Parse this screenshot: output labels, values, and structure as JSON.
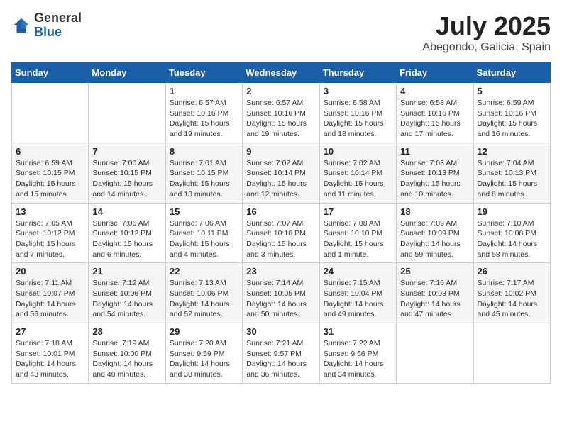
{
  "logo": {
    "general": "General",
    "blue": "Blue"
  },
  "title": "July 2025",
  "location": "Abegondo, Galicia, Spain",
  "weekdays": [
    "Sunday",
    "Monday",
    "Tuesday",
    "Wednesday",
    "Thursday",
    "Friday",
    "Saturday"
  ],
  "weeks": [
    [
      {
        "day": "",
        "info": ""
      },
      {
        "day": "",
        "info": ""
      },
      {
        "day": "1",
        "info": "Sunrise: 6:57 AM\nSunset: 10:16 PM\nDaylight: 15 hours\nand 19 minutes."
      },
      {
        "day": "2",
        "info": "Sunrise: 6:57 AM\nSunset: 10:16 PM\nDaylight: 15 hours\nand 19 minutes."
      },
      {
        "day": "3",
        "info": "Sunrise: 6:58 AM\nSunset: 10:16 PM\nDaylight: 15 hours\nand 18 minutes."
      },
      {
        "day": "4",
        "info": "Sunrise: 6:58 AM\nSunset: 10:16 PM\nDaylight: 15 hours\nand 17 minutes."
      },
      {
        "day": "5",
        "info": "Sunrise: 6:59 AM\nSunset: 10:16 PM\nDaylight: 15 hours\nand 16 minutes."
      }
    ],
    [
      {
        "day": "6",
        "info": "Sunrise: 6:59 AM\nSunset: 10:15 PM\nDaylight: 15 hours\nand 15 minutes."
      },
      {
        "day": "7",
        "info": "Sunrise: 7:00 AM\nSunset: 10:15 PM\nDaylight: 15 hours\nand 14 minutes."
      },
      {
        "day": "8",
        "info": "Sunrise: 7:01 AM\nSunset: 10:15 PM\nDaylight: 15 hours\nand 13 minutes."
      },
      {
        "day": "9",
        "info": "Sunrise: 7:02 AM\nSunset: 10:14 PM\nDaylight: 15 hours\nand 12 minutes."
      },
      {
        "day": "10",
        "info": "Sunrise: 7:02 AM\nSunset: 10:14 PM\nDaylight: 15 hours\nand 11 minutes."
      },
      {
        "day": "11",
        "info": "Sunrise: 7:03 AM\nSunset: 10:13 PM\nDaylight: 15 hours\nand 10 minutes."
      },
      {
        "day": "12",
        "info": "Sunrise: 7:04 AM\nSunset: 10:13 PM\nDaylight: 15 hours\nand 8 minutes."
      }
    ],
    [
      {
        "day": "13",
        "info": "Sunrise: 7:05 AM\nSunset: 10:12 PM\nDaylight: 15 hours\nand 7 minutes."
      },
      {
        "day": "14",
        "info": "Sunrise: 7:06 AM\nSunset: 10:12 PM\nDaylight: 15 hours\nand 6 minutes."
      },
      {
        "day": "15",
        "info": "Sunrise: 7:06 AM\nSunset: 10:11 PM\nDaylight: 15 hours\nand 4 minutes."
      },
      {
        "day": "16",
        "info": "Sunrise: 7:07 AM\nSunset: 10:10 PM\nDaylight: 15 hours\nand 3 minutes."
      },
      {
        "day": "17",
        "info": "Sunrise: 7:08 AM\nSunset: 10:10 PM\nDaylight: 15 hours\nand 1 minute."
      },
      {
        "day": "18",
        "info": "Sunrise: 7:09 AM\nSunset: 10:09 PM\nDaylight: 14 hours\nand 59 minutes."
      },
      {
        "day": "19",
        "info": "Sunrise: 7:10 AM\nSunset: 10:08 PM\nDaylight: 14 hours\nand 58 minutes."
      }
    ],
    [
      {
        "day": "20",
        "info": "Sunrise: 7:11 AM\nSunset: 10:07 PM\nDaylight: 14 hours\nand 56 minutes."
      },
      {
        "day": "21",
        "info": "Sunrise: 7:12 AM\nSunset: 10:06 PM\nDaylight: 14 hours\nand 54 minutes."
      },
      {
        "day": "22",
        "info": "Sunrise: 7:13 AM\nSunset: 10:06 PM\nDaylight: 14 hours\nand 52 minutes."
      },
      {
        "day": "23",
        "info": "Sunrise: 7:14 AM\nSunset: 10:05 PM\nDaylight: 14 hours\nand 50 minutes."
      },
      {
        "day": "24",
        "info": "Sunrise: 7:15 AM\nSunset: 10:04 PM\nDaylight: 14 hours\nand 49 minutes."
      },
      {
        "day": "25",
        "info": "Sunrise: 7:16 AM\nSunset: 10:03 PM\nDaylight: 14 hours\nand 47 minutes."
      },
      {
        "day": "26",
        "info": "Sunrise: 7:17 AM\nSunset: 10:02 PM\nDaylight: 14 hours\nand 45 minutes."
      }
    ],
    [
      {
        "day": "27",
        "info": "Sunrise: 7:18 AM\nSunset: 10:01 PM\nDaylight: 14 hours\nand 43 minutes."
      },
      {
        "day": "28",
        "info": "Sunrise: 7:19 AM\nSunset: 10:00 PM\nDaylight: 14 hours\nand 40 minutes."
      },
      {
        "day": "29",
        "info": "Sunrise: 7:20 AM\nSunset: 9:59 PM\nDaylight: 14 hours\nand 38 minutes."
      },
      {
        "day": "30",
        "info": "Sunrise: 7:21 AM\nSunset: 9:57 PM\nDaylight: 14 hours\nand 36 minutes."
      },
      {
        "day": "31",
        "info": "Sunrise: 7:22 AM\nSunset: 9:56 PM\nDaylight: 14 hours\nand 34 minutes."
      },
      {
        "day": "",
        "info": ""
      },
      {
        "day": "",
        "info": ""
      }
    ]
  ]
}
